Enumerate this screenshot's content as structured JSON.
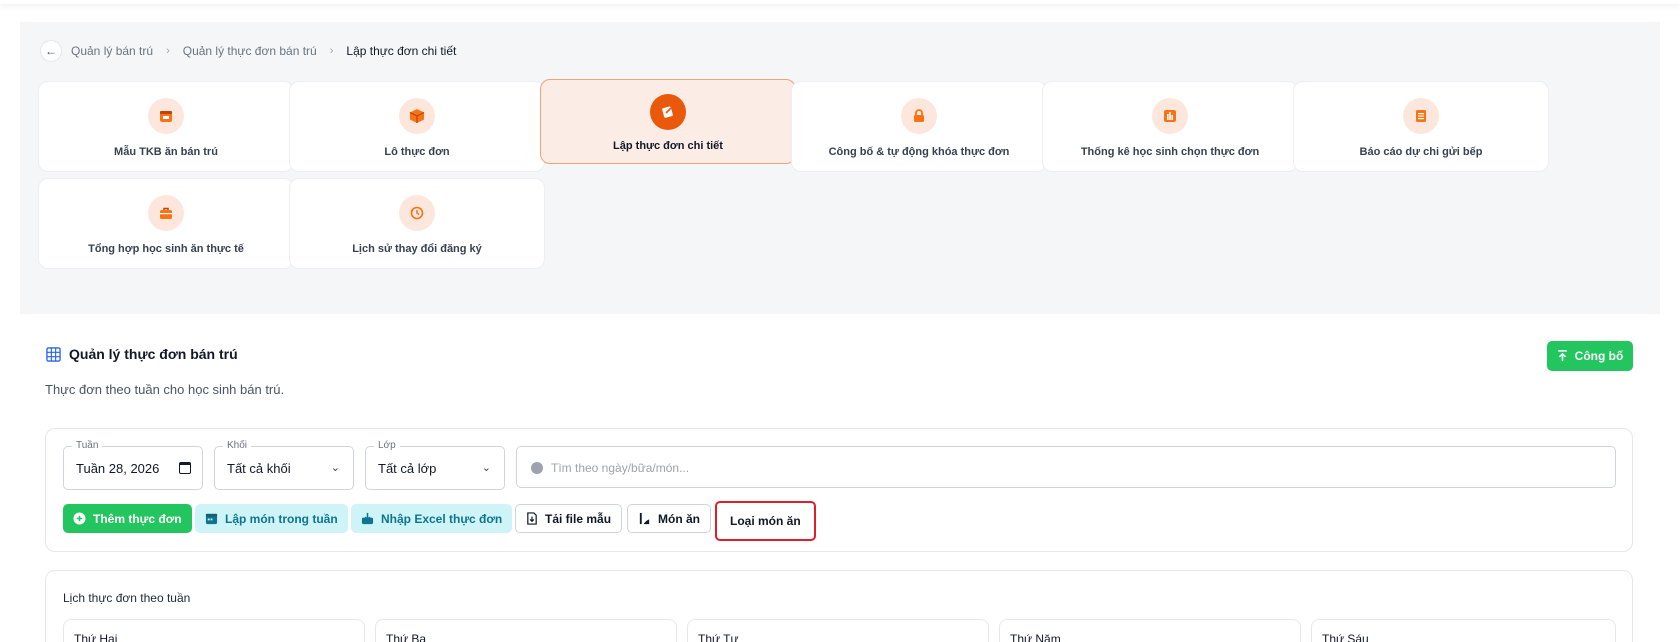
{
  "breadcrumb": {
    "items": [
      "Quản lý bán trú",
      "Quản lý thực đơn bán trú"
    ],
    "current": "Lập thực đơn chi tiết"
  },
  "cards": [
    {
      "label": "Mẫu TKB ăn bán trú",
      "icon": "calendar-icon"
    },
    {
      "label": "Lô thực đơn",
      "icon": "box-icon"
    },
    {
      "label": "Lập thực đơn chi tiết",
      "icon": "edit-document-icon",
      "active": true
    },
    {
      "label": "Công bố & tự động khóa thực đơn",
      "icon": "lock-icon"
    },
    {
      "label": "Thống kê học sinh chọn thực đơn",
      "icon": "bar-chart-icon"
    },
    {
      "label": "Báo cáo dự chi gửi bếp",
      "icon": "list-document-icon"
    },
    {
      "label": "Tổng hợp học sinh ăn thực tế",
      "icon": "bag-icon"
    },
    {
      "label": "Lịch sử thay đổi đăng ký",
      "icon": "history-icon"
    }
  ],
  "section": {
    "title": "Quản lý thực đơn bán trú",
    "subtitle": "Thực đơn theo tuần cho học sinh bán trú.",
    "publish_label": "Công bố"
  },
  "filters": {
    "week_label": "Tuần",
    "week_value": "Tuần 28, 2026",
    "grade_label": "Khối",
    "grade_value": "Tất cả khối",
    "class_label": "Lớp",
    "class_value": "Tất cả lớp",
    "search_placeholder": "Tìm theo ngày/bữa/món..."
  },
  "actions": {
    "add_menu": "Thêm thực đơn",
    "plan_week": "Lập món trong tuần",
    "import_excel": "Nhập Excel thực đơn",
    "download_template": "Tải file mẫu",
    "dishes": "Món ăn",
    "dish_types": "Loại món ăn"
  },
  "schedule": {
    "title": "Lịch thực đơn theo tuần",
    "days": [
      "Thứ Hai",
      "Thứ Ba",
      "Thứ Tư",
      "Thứ Năm",
      "Thứ Sáu"
    ]
  },
  "colors": {
    "accent": "#ea580c",
    "green": "#22c55e",
    "highlight": "#e11d2a"
  }
}
